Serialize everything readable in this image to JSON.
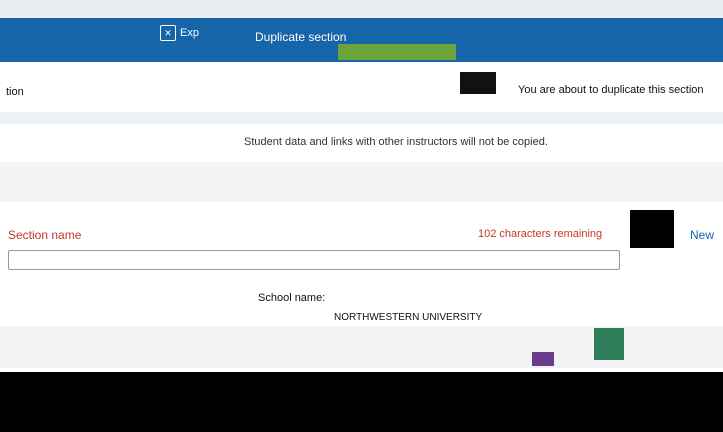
{
  "header": {
    "exp_label": "Exp",
    "close_glyph": "✕",
    "dialog_title": "Duplicate section"
  },
  "dialog": {
    "intro": "You are about to duplicate this section",
    "side_label": "tion",
    "warning": "Student data and links with other instructors will not be copied."
  },
  "form": {
    "section_name_label": "Section name",
    "chars_remaining": "102 characters remaining",
    "new_label": "New",
    "section_name_value": "",
    "school_name_label": "School name:",
    "school_name_value": "NORTHWESTERN UNIVERSITY"
  },
  "colors": {
    "header_bg": "#1565a8",
    "accent_green": "#6ba53a",
    "error_red": "#c0392b",
    "link_blue": "#1a5fb4"
  }
}
